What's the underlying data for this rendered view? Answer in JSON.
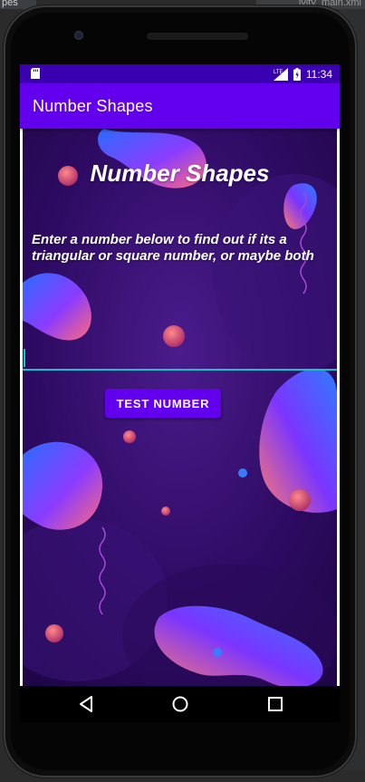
{
  "ide": {
    "top_left_text": "pes",
    "top_right_text": "ivity_main.xml"
  },
  "status_bar": {
    "network_label": "LTE",
    "time": "11:34"
  },
  "app_bar": {
    "title": "Number Shapes"
  },
  "content": {
    "heading": "Number Shapes",
    "instructions": "Enter a number below to find out if its a triangular or square number, or maybe both",
    "input": {
      "value": "",
      "placeholder": ""
    },
    "button_label": "TEST NUMBER"
  },
  "navigation": {
    "back": "back-icon",
    "home": "home-icon",
    "recents": "recents-icon"
  },
  "colors": {
    "status_bar": "#3a00b0",
    "app_bar": "#6200ee",
    "accent": "#14c4c8",
    "button": "#6200ee"
  }
}
